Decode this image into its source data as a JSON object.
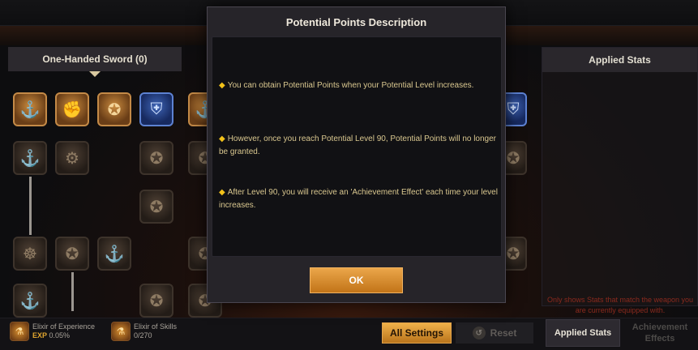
{
  "background": {
    "left_panel_title": "One-Handed Sword (0)",
    "right_panel_title": "Applied Stats",
    "right_panel_note": "Only shows Stats that match the weapon you are currently equipped with.",
    "elixirs": [
      {
        "name": "Elixir of Experience",
        "value_key": "EXP",
        "value": "0.05%",
        "icon": "elixir-flask-icon"
      },
      {
        "name": "Elixir of Skills",
        "value_key": "",
        "value": "0/270",
        "icon": "elixir-flask-icon"
      }
    ],
    "buttons": {
      "all_settings": "All Settings",
      "reset": "Reset"
    },
    "tabs": [
      {
        "label": "Applied Stats",
        "active": true
      },
      {
        "label": "Achievement Effects",
        "active": false
      }
    ]
  },
  "modal": {
    "title": "Potential Points Description",
    "lines": [
      "You can obtain Potential Points when your Potential Level increases.",
      "However, once you reach Potential Level 90, Potential Points will no longer be granted.",
      "After Level 90, you will receive an 'Achievement Effect' each time your level increases."
    ],
    "bullet_glyph": "◆",
    "ok_label": "OK"
  },
  "colors": {
    "accent_orange": "#e09a3a",
    "bullet_yellow": "#f2c21a",
    "note_red": "#8b2a1e"
  }
}
